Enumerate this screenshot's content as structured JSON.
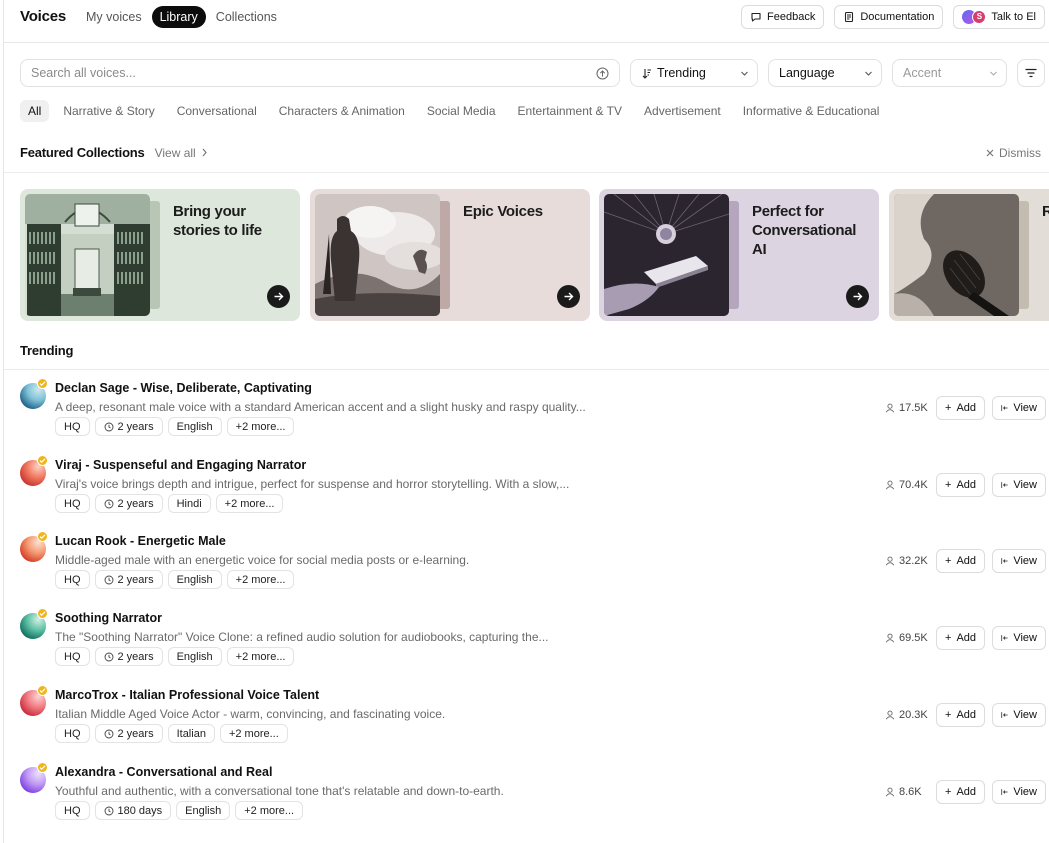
{
  "header": {
    "brand": "Voices",
    "tabs": [
      {
        "label": "My voices",
        "active": false
      },
      {
        "label": "Library",
        "active": true
      },
      {
        "label": "Collections",
        "active": false
      }
    ],
    "actions": {
      "feedback": "Feedback",
      "documentation": "Documentation",
      "talk": "Talk to El",
      "talk_avatar_letter": "S"
    }
  },
  "search": {
    "placeholder": "Search all voices...",
    "sort": "Trending",
    "language": "Language",
    "accent": "Accent"
  },
  "categories": [
    {
      "label": "All",
      "active": true
    },
    {
      "label": "Narrative & Story",
      "active": false
    },
    {
      "label": "Conversational",
      "active": false
    },
    {
      "label": "Characters & Animation",
      "active": false
    },
    {
      "label": "Social Media",
      "active": false
    },
    {
      "label": "Entertainment & TV",
      "active": false
    },
    {
      "label": "Advertisement",
      "active": false
    },
    {
      "label": "Informative & Educational",
      "active": false
    }
  ],
  "featured": {
    "title": "Featured Collections",
    "view_all": "View all",
    "dismiss": "Dismiss",
    "cards": [
      {
        "title": "Bring your stories to life",
        "bg": "#dde7db",
        "image": "library-illustration"
      },
      {
        "title": "Epic Voices",
        "bg": "#e8dcda",
        "image": "warrior-illustration"
      },
      {
        "title": "Perfect for Conversational AI",
        "bg": "#ddd4e2",
        "image": "phone-hand-illustration"
      },
      {
        "title": "R M",
        "bg": "#e2ddd6",
        "image": "microphone-illustration"
      }
    ]
  },
  "trending": {
    "title": "Trending",
    "add_label": "Add",
    "view_label": "View",
    "voices": [
      {
        "name": "Declan Sage - Wise, Deliberate, Captivating",
        "description": "A deep, resonant male voice with a standard American accent and a slight husky and raspy quality...",
        "quality": "HQ",
        "age": "2 years",
        "language": "English",
        "more": "+2 more...",
        "uses": "17.5K",
        "avatar_colors": [
          "#1d5f86",
          "#7fc2d8",
          "#cfe7ee"
        ]
      },
      {
        "name": "Viraj - Suspenseful and Engaging Narrator",
        "description": "Viraj's voice brings depth and intrigue, perfect for suspense and horror storytelling. With a slow,...",
        "quality": "HQ",
        "age": "2 years",
        "language": "Hindi",
        "more": "+2 more...",
        "uses": "70.4K",
        "avatar_colors": [
          "#c8322e",
          "#f27d63",
          "#fbd2c6"
        ]
      },
      {
        "name": "Lucan Rook - Energetic Male",
        "description": "Middle-aged male with an energetic voice for social media posts or e-learning.",
        "quality": "HQ",
        "age": "2 years",
        "language": "English",
        "more": "+2 more...",
        "uses": "32.2K",
        "avatar_colors": [
          "#d33a26",
          "#f49a72",
          "#fde0d2"
        ]
      },
      {
        "name": "Soothing Narrator",
        "description": "The \"Soothing Narrator\" Voice Clone: a refined audio solution for audiobooks, capturing the...",
        "quality": "HQ",
        "age": "2 years",
        "language": "English",
        "more": "+2 more...",
        "uses": "69.5K",
        "avatar_colors": [
          "#0f6d5e",
          "#5fc2a6",
          "#d5efe6"
        ]
      },
      {
        "name": "MarcoTrox - Italian Professional Voice Talent",
        "description": "Italian Middle Aged Voice Actor - warm, convincing, and fascinating voice.",
        "quality": "HQ",
        "age": "2 years",
        "language": "Italian",
        "more": "+2 more...",
        "uses": "20.3K",
        "avatar_colors": [
          "#c8283a",
          "#f27f85",
          "#fbd3d5"
        ]
      },
      {
        "name": "Alexandra - Conversational and Real",
        "description": "Youthful and authentic, with a conversational tone that's relatable and down-to-earth.",
        "quality": "HQ",
        "age": "180 days",
        "language": "English",
        "more": "+2 more...",
        "uses": "8.6K",
        "avatar_colors": [
          "#7c3fe0",
          "#c29cf5",
          "#ece0fd"
        ]
      }
    ]
  }
}
